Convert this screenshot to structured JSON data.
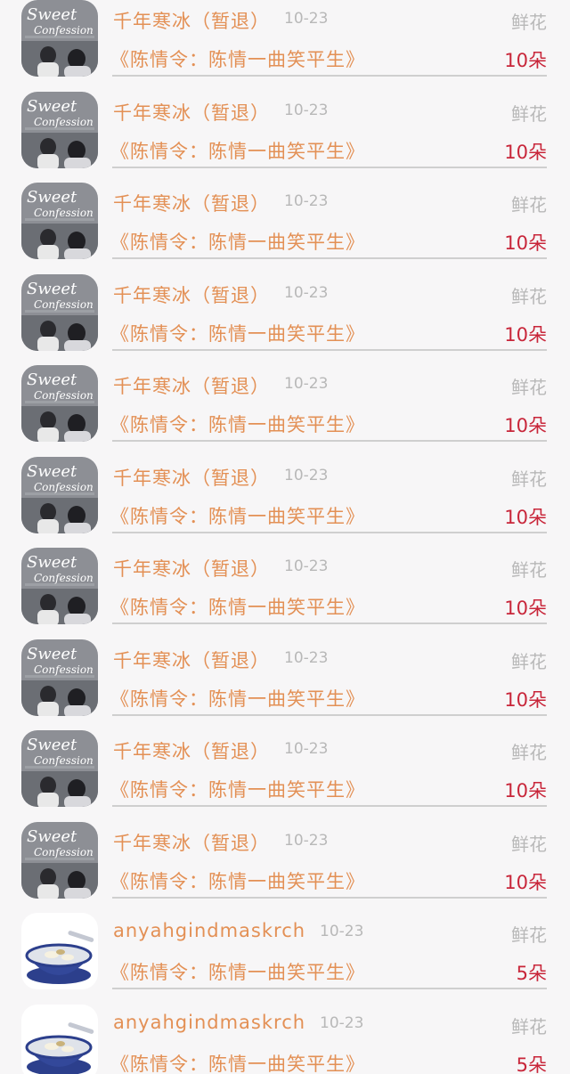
{
  "gift_list": [
    {
      "avatar": "sweet-confession-cover",
      "name": "千年寒冰（暂退）",
      "date": "10-23",
      "gift_type": "鲜花",
      "work_title": "《陈情令：陈情一曲笑平生》",
      "count": "10朵"
    },
    {
      "avatar": "sweet-confession-cover",
      "name": "千年寒冰（暂退）",
      "date": "10-23",
      "gift_type": "鲜花",
      "work_title": "《陈情令：陈情一曲笑平生》",
      "count": "10朵"
    },
    {
      "avatar": "sweet-confession-cover",
      "name": "千年寒冰（暂退）",
      "date": "10-23",
      "gift_type": "鲜花",
      "work_title": "《陈情令：陈情一曲笑平生》",
      "count": "10朵"
    },
    {
      "avatar": "sweet-confession-cover",
      "name": "千年寒冰（暂退）",
      "date": "10-23",
      "gift_type": "鲜花",
      "work_title": "《陈情令：陈情一曲笑平生》",
      "count": "10朵"
    },
    {
      "avatar": "sweet-confession-cover",
      "name": "千年寒冰（暂退）",
      "date": "10-23",
      "gift_type": "鲜花",
      "work_title": "《陈情令：陈情一曲笑平生》",
      "count": "10朵"
    },
    {
      "avatar": "sweet-confession-cover",
      "name": "千年寒冰（暂退）",
      "date": "10-23",
      "gift_type": "鲜花",
      "work_title": "《陈情令：陈情一曲笑平生》",
      "count": "10朵"
    },
    {
      "avatar": "sweet-confession-cover",
      "name": "千年寒冰（暂退）",
      "date": "10-23",
      "gift_type": "鲜花",
      "work_title": "《陈情令：陈情一曲笑平生》",
      "count": "10朵"
    },
    {
      "avatar": "sweet-confession-cover",
      "name": "千年寒冰（暂退）",
      "date": "10-23",
      "gift_type": "鲜花",
      "work_title": "《陈情令：陈情一曲笑平生》",
      "count": "10朵"
    },
    {
      "avatar": "sweet-confession-cover",
      "name": "千年寒冰（暂退）",
      "date": "10-23",
      "gift_type": "鲜花",
      "work_title": "《陈情令：陈情一曲笑平生》",
      "count": "10朵"
    },
    {
      "avatar": "sweet-confession-cover",
      "name": "千年寒冰（暂退）",
      "date": "10-23",
      "gift_type": "鲜花",
      "work_title": "《陈情令：陈情一曲笑平生》",
      "count": "10朵"
    },
    {
      "avatar": "dessert-bowl",
      "name": "anyahgindmaskrch",
      "date": "10-23",
      "gift_type": "鲜花",
      "work_title": "《陈情令：陈情一曲笑平生》",
      "count": "5朵"
    },
    {
      "avatar": "dessert-bowl",
      "name": "anyahgindmaskrch",
      "date": "10-23",
      "gift_type": "鲜花",
      "work_title": "《陈情令：陈情一曲笑平生》",
      "count": "5朵"
    }
  ],
  "avatar_logo_text": "Sweet Confession",
  "colors": {
    "background": "#f7f6f7",
    "name_text": "#e39055",
    "meta_text": "#b8b8b8",
    "count_text": "#c8263a",
    "divider": "#cfcfcf"
  }
}
